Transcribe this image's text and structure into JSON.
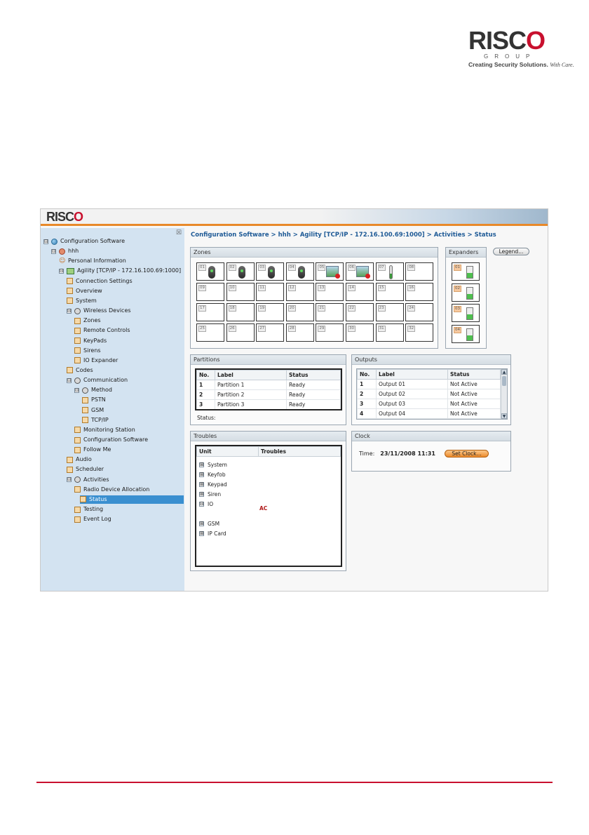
{
  "doc_logo": {
    "brand_pre": "RISC",
    "brand_o": "O",
    "group": "GROUP",
    "tagline": "Creating Security Solutions.",
    "tagline_script": "With Care."
  },
  "app": {
    "logo_pre": "RISC",
    "logo_o": "O",
    "close_glyph": "☒",
    "breadcrumb": "Configuration Software > hhh > Agility [TCP/IP - 172.16.100.69:1000] > Activities > Status"
  },
  "tree": [
    {
      "label": "Configuration Software",
      "expander": "⊟",
      "icon": "globe"
    },
    {
      "label": "hhh",
      "expander": "⊟",
      "icon": "net"
    },
    {
      "label": "Personal Information",
      "icon": "user"
    },
    {
      "label": "Agility [TCP/IP - 172.16.100.69:1000]",
      "expander": "⊟",
      "icon": "dev"
    },
    {
      "label": "Connection Settings",
      "icon": "page"
    },
    {
      "label": "Overview",
      "icon": "page"
    },
    {
      "label": "System",
      "icon": "page"
    },
    {
      "label": "Wireless Devices",
      "expander": "⊟",
      "icon": "gear"
    },
    {
      "label": "Zones",
      "icon": "page"
    },
    {
      "label": "Remote Controls",
      "icon": "page"
    },
    {
      "label": "KeyPads",
      "icon": "page"
    },
    {
      "label": "Sirens",
      "icon": "page"
    },
    {
      "label": "IO Expander",
      "icon": "page"
    },
    {
      "label": "Codes",
      "icon": "page"
    },
    {
      "label": "Communication",
      "expander": "⊟",
      "icon": "gear"
    },
    {
      "label": "Method",
      "expander": "⊟",
      "icon": "gear"
    },
    {
      "label": "PSTN",
      "icon": "page"
    },
    {
      "label": "GSM",
      "icon": "page"
    },
    {
      "label": "TCP/IP",
      "icon": "page"
    },
    {
      "label": "Monitoring Station",
      "icon": "page"
    },
    {
      "label": "Configuration Software",
      "icon": "page"
    },
    {
      "label": "Follow Me",
      "icon": "page"
    },
    {
      "label": "Audio",
      "icon": "page"
    },
    {
      "label": "Scheduler",
      "icon": "page"
    },
    {
      "label": "Activities",
      "expander": "⊟",
      "icon": "gear"
    },
    {
      "label": "Radio Device Allocation",
      "icon": "page"
    },
    {
      "label": "Status",
      "icon": "page",
      "selected": true
    },
    {
      "label": "Testing",
      "icon": "page"
    },
    {
      "label": "Event Log",
      "icon": "page"
    }
  ],
  "zones": {
    "title": "Zones",
    "items": [
      {
        "no": "01",
        "device": "detector"
      },
      {
        "no": "02",
        "device": "detector"
      },
      {
        "no": "03",
        "device": "detector"
      },
      {
        "no": "04",
        "device": "detector"
      },
      {
        "no": "05",
        "device": "camera-alert"
      },
      {
        "no": "06",
        "device": "flood-alert"
      },
      {
        "no": "07",
        "device": "thermometer"
      },
      {
        "no": "08",
        "device": ""
      },
      {
        "no": "09",
        "device": ""
      },
      {
        "no": "10",
        "device": ""
      },
      {
        "no": "11",
        "device": ""
      },
      {
        "no": "12",
        "device": ""
      },
      {
        "no": "13",
        "device": ""
      },
      {
        "no": "14",
        "device": ""
      },
      {
        "no": "15",
        "device": ""
      },
      {
        "no": "16",
        "device": ""
      },
      {
        "no": "17",
        "device": ""
      },
      {
        "no": "18",
        "device": ""
      },
      {
        "no": "19",
        "device": ""
      },
      {
        "no": "20",
        "device": ""
      },
      {
        "no": "21",
        "device": ""
      },
      {
        "no": "22",
        "device": ""
      },
      {
        "no": "23",
        "device": ""
      },
      {
        "no": "24",
        "device": ""
      },
      {
        "no": "25",
        "device": ""
      },
      {
        "no": "26",
        "device": ""
      },
      {
        "no": "27",
        "device": ""
      },
      {
        "no": "28",
        "device": ""
      },
      {
        "no": "29",
        "device": ""
      },
      {
        "no": "30",
        "device": ""
      },
      {
        "no": "31",
        "device": ""
      },
      {
        "no": "32",
        "device": ""
      }
    ]
  },
  "expanders": {
    "title": "Expanders",
    "items": [
      {
        "no": "01"
      },
      {
        "no": "02"
      },
      {
        "no": "03"
      },
      {
        "no": "04"
      }
    ]
  },
  "legend_button": "Legend...",
  "partitions": {
    "title": "Partitions",
    "columns": [
      "No.",
      "Label",
      "Status"
    ],
    "rows": [
      [
        "1",
        "Partition 1",
        "Ready"
      ],
      [
        "2",
        "Partition 2",
        "Ready"
      ],
      [
        "3",
        "Partition 3",
        "Ready"
      ]
    ],
    "status_label": "Status:"
  },
  "outputs": {
    "title": "Outputs",
    "columns": [
      "No.",
      "Label",
      "Status"
    ],
    "rows": [
      [
        "1",
        "Output 01",
        "Not Active"
      ],
      [
        "2",
        "Output 02",
        "Not Active"
      ],
      [
        "3",
        "Output 03",
        "Not Active"
      ],
      [
        "4",
        "Output 04",
        "Not Active"
      ]
    ]
  },
  "troubles": {
    "title": "Troubles",
    "columns": [
      "Unit",
      "Troubles"
    ],
    "items": [
      {
        "label": "System",
        "expander": "⊞"
      },
      {
        "label": "Keyfob",
        "expander": "⊞"
      },
      {
        "label": "Keypad",
        "expander": "⊞"
      },
      {
        "label": "Siren",
        "expander": "⊞"
      },
      {
        "label": "IO",
        "expander": "⊟"
      },
      {
        "label": "GSM",
        "expander": "⊞"
      },
      {
        "label": "IP Card",
        "expander": "⊞"
      }
    ],
    "io_trouble": "AC"
  },
  "clock": {
    "title": "Clock",
    "time_label": "Time:",
    "time_value": "23/11/2008 11:31",
    "set_button": "Set Clock..."
  },
  "colors": {
    "accent": "#c8102e",
    "header_bar": "#e8892a",
    "selected": "#3a8fd0",
    "tree_bg": "#d3e3f1"
  }
}
